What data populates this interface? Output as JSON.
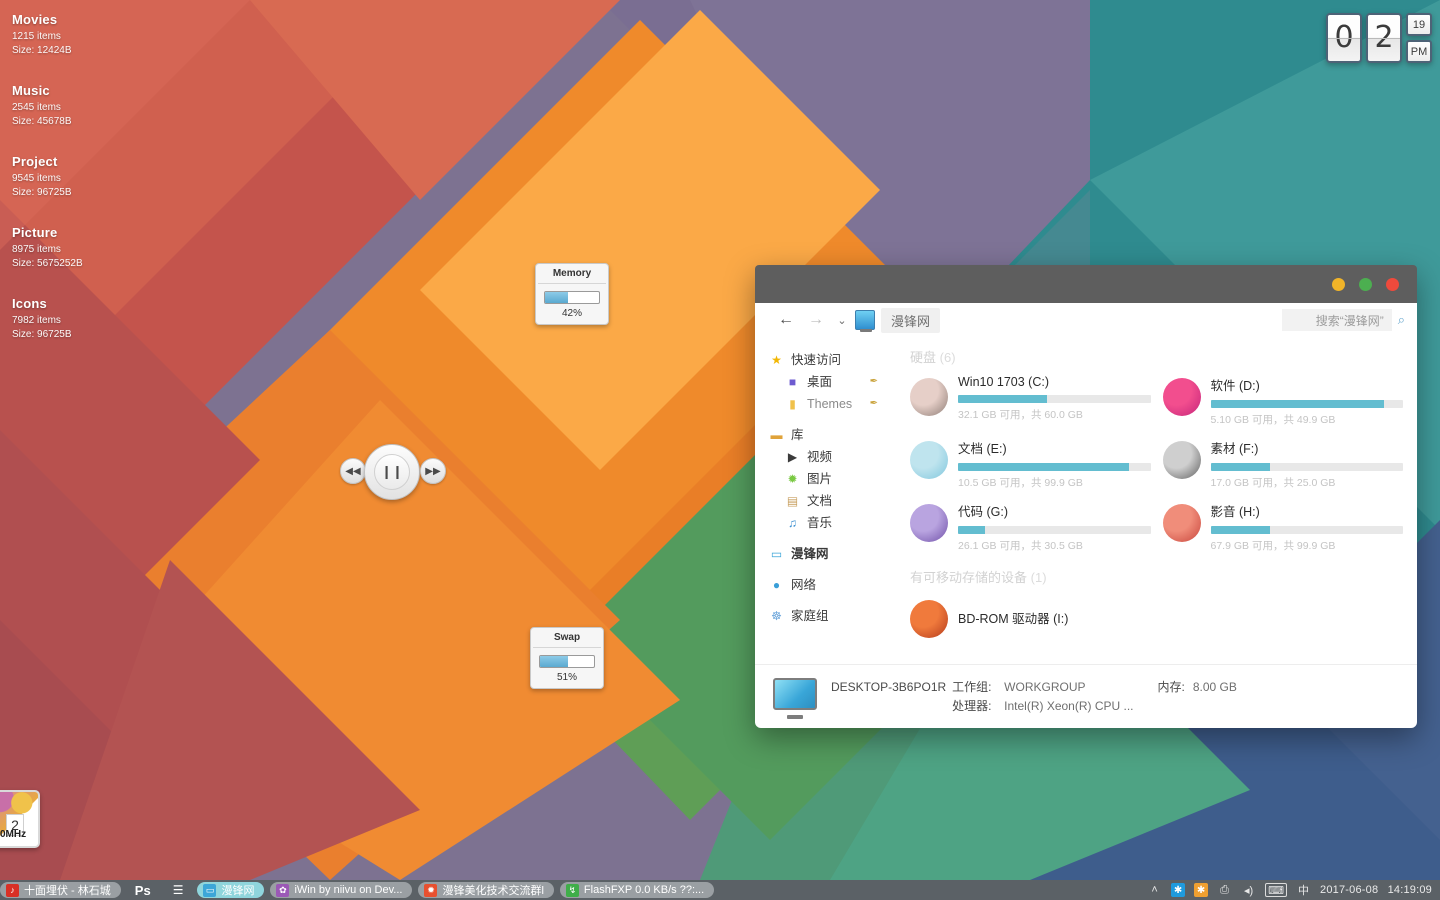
{
  "desktop": {
    "folder_stats": [
      {
        "title": "Movies",
        "items": "1215 items",
        "size": "Size: 12424B"
      },
      {
        "title": "Music",
        "items": "2545 items",
        "size": "Size: 45678B"
      },
      {
        "title": "Project",
        "items": "9545 items",
        "size": "Size: 96725B"
      },
      {
        "title": "Picture",
        "items": "8975 items",
        "size": "Size: 5675252B"
      },
      {
        "title": "Icons",
        "items": "7982 items",
        "size": "Size: 96725B"
      }
    ],
    "clock": {
      "hour_tens": "0",
      "hour_ones": "2",
      "minutes": "19",
      "meridiem": "PM"
    },
    "gauges": [
      {
        "title": "Memory",
        "value": "42%",
        "percent": 42
      },
      {
        "title": "Swap",
        "value": "51%",
        "percent": 51
      }
    ],
    "media": {
      "prev_icon": "◀◀",
      "play_icon": "❙❙",
      "next_icon": "▶▶"
    },
    "cpu_widget": {
      "number": "2",
      "freq": "0MHz"
    }
  },
  "explorer": {
    "window_buttons": {
      "minimize": "minimize",
      "maximize": "maximize",
      "close": "close"
    },
    "toolbar": {
      "back": "←",
      "forward": "→",
      "dropdown": "⌄",
      "breadcrumb": "漫锋网",
      "search_placeholder": "搜索“漫锋网”",
      "search_value": "搜索“漫锋网”",
      "search_icon": "⌕"
    },
    "nav": {
      "items": [
        {
          "label": "快速访问",
          "icon": "★",
          "color": "#f2b705",
          "indent": false,
          "pin": false,
          "gap": false,
          "bold": false,
          "muted": false
        },
        {
          "label": "桌面",
          "icon": "■",
          "color": "#6d5bd0",
          "indent": true,
          "pin": true,
          "gap": false,
          "bold": false,
          "muted": false
        },
        {
          "label": "Themes",
          "icon": "▮",
          "color": "#f0c14b",
          "indent": true,
          "pin": true,
          "gap": false,
          "bold": false,
          "muted": true
        },
        {
          "label": "库",
          "icon": "▬",
          "color": "#e0a33a",
          "indent": false,
          "pin": false,
          "gap": true,
          "bold": false,
          "muted": false
        },
        {
          "label": "视频",
          "icon": "▶",
          "color": "#3b3b3b",
          "indent": true,
          "pin": false,
          "gap": false,
          "bold": false,
          "muted": false
        },
        {
          "label": "图片",
          "icon": "✹",
          "color": "#7ac943",
          "indent": true,
          "pin": false,
          "gap": false,
          "bold": false,
          "muted": false
        },
        {
          "label": "文档",
          "icon": "▤",
          "color": "#c8a060",
          "indent": true,
          "pin": false,
          "gap": false,
          "bold": false,
          "muted": false
        },
        {
          "label": "音乐",
          "icon": "♫",
          "color": "#3b8fd0",
          "indent": true,
          "pin": false,
          "gap": false,
          "bold": false,
          "muted": false
        },
        {
          "label": "漫锋网",
          "icon": "▭",
          "color": "#3ca6d8",
          "indent": false,
          "pin": false,
          "gap": true,
          "bold": true,
          "muted": false
        },
        {
          "label": "网络",
          "icon": "●",
          "color": "#3a9fd8",
          "indent": false,
          "pin": false,
          "gap": true,
          "bold": false,
          "muted": false
        },
        {
          "label": "家庭组",
          "icon": "☸",
          "color": "#6fa8dc",
          "indent": false,
          "pin": false,
          "gap": true,
          "bold": false,
          "muted": false
        }
      ]
    },
    "sections": {
      "drives_header": "硬盘",
      "drives_count": "(6)",
      "removable_header": "有可移动存储的设备",
      "removable_count": "(1)"
    },
    "drives": [
      {
        "name": "Win10 1703 (C:)",
        "free": "32.1 GB 可用，共 60.0 GB",
        "percent": 46,
        "icon_a": "#e6cfc8",
        "icon_b": "#8c7b74"
      },
      {
        "name": "软件 (D:)",
        "free": "5.10 GB 可用，共 49.9 GB",
        "percent": 90,
        "icon_a": "#f24e8e",
        "icon_b": "#c4247a"
      },
      {
        "name": "文档 (E:)",
        "free": "10.5 GB 可用，共 99.9 GB",
        "percent": 89,
        "icon_a": "#bfe4ee",
        "icon_b": "#7fc6dd"
      },
      {
        "name": "素材 (F:)",
        "free": "17.0 GB 可用，共 25.0 GB",
        "percent": 31,
        "icon_a": "#cfcfcf",
        "icon_b": "#5d5d5d"
      },
      {
        "name": "代码 (G:)",
        "free": "26.1 GB 可用，共 30.5 GB",
        "percent": 14,
        "icon_a": "#b9a4e0",
        "icon_b": "#6f4fa8"
      },
      {
        "name": "影音 (H:)",
        "free": "67.9 GB 可用，共 99.9 GB",
        "percent": 31,
        "icon_a": "#f08d7a",
        "icon_b": "#c8453c"
      }
    ],
    "removable": [
      {
        "name": "BD-ROM 驱动器 (I:)",
        "icon_a": "#f07a3c",
        "icon_b": "#b33a1c"
      }
    ],
    "status": {
      "computer_name": "DESKTOP-3B6PO1R",
      "workgroup_key": "工作组:",
      "workgroup_val": "WORKGROUP",
      "memory_key": "内存:",
      "memory_val": "8.00 GB",
      "cpu_key": "处理器:",
      "cpu_val": "Intel(R) Xeon(R) CPU  ..."
    }
  },
  "taskbar": {
    "items": [
      {
        "label": "十面埋伏 - 林石城",
        "icon": "♪",
        "icon_bg": "#d93025",
        "style": "normal"
      },
      {
        "label": "Ps",
        "icon": "",
        "icon_bg": "transparent",
        "style": "plain"
      },
      {
        "label": "☰",
        "icon": "",
        "icon_bg": "transparent",
        "style": "plain"
      },
      {
        "label": "漫锋网",
        "icon": "▭",
        "icon_bg": "#3ca6d8",
        "style": "active"
      },
      {
        "label": "iWin by niivu on Dev...",
        "icon": "✿",
        "icon_bg": "#9b59b6",
        "style": "normal"
      },
      {
        "label": "漫锋美化技术交流群l",
        "icon": "✹",
        "icon_bg": "#e8502f",
        "style": "normal"
      },
      {
        "label": "FlashFXP 0.0 KB/s ??:...",
        "icon": "↯",
        "icon_bg": "#3fae49",
        "style": "normal"
      }
    ],
    "tray": {
      "chevron": "˄",
      "icons": [
        "✱",
        "✱",
        "⎙",
        "◂)",
        "⌨",
        "中"
      ],
      "date": "2017-06-08",
      "time": "14:19:09"
    }
  }
}
